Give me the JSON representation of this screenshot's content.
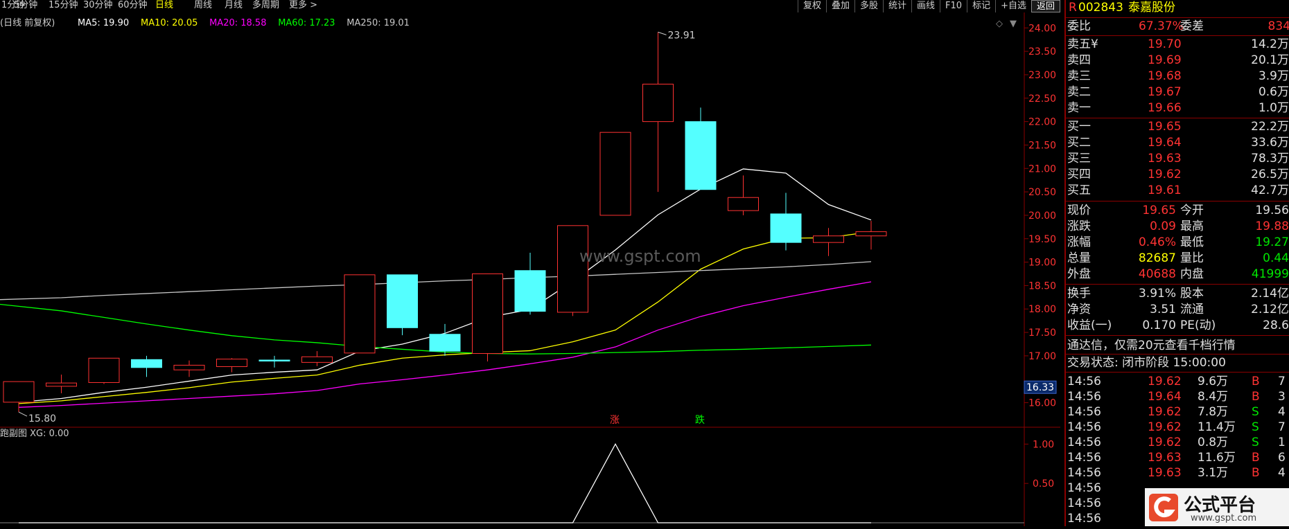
{
  "periods": [
    "1分钟",
    "5分钟",
    "15分钟",
    "30分钟",
    "60分钟",
    "日线",
    "周线",
    "月线",
    "多周期",
    "更多 >"
  ],
  "active_period": "日线",
  "toolbar": [
    "复权",
    "叠加",
    "多股",
    "统计",
    "画线",
    "F10",
    "标记",
    "+自选",
    "返回"
  ],
  "ma_legend": {
    "prefix": "(日线 前复权)",
    "items": [
      {
        "label": "MA5: 19.90",
        "color": "#ffffff"
      },
      {
        "label": "MA10: 20.05",
        "color": "#ffff00"
      },
      {
        "label": "MA20: 18.58",
        "color": "#ff00ff"
      },
      {
        "label": "MA60: 17.23",
        "color": "#00ff00"
      },
      {
        "label": "MA250: 19.01",
        "color": "#c8c8c8"
      }
    ]
  },
  "watermark": "www.gspt.com",
  "chart_data": {
    "type": "candlestick",
    "ylim": [
      15.55,
      24.3
    ],
    "yticks": [
      "24.00",
      "23.50",
      "23.00",
      "22.50",
      "22.00",
      "21.50",
      "21.00",
      "20.50",
      "20.00",
      "19.50",
      "19.00",
      "18.50",
      "18.00",
      "17.50",
      "17.00",
      "16.00"
    ],
    "current_price_tag": "16.33",
    "max_label": "23.91",
    "min_label": "15.80",
    "candles": [
      {
        "o": 16.01,
        "h": 16.45,
        "l": 15.8,
        "c": 16.45
      },
      {
        "o": 16.35,
        "h": 16.6,
        "l": 16.2,
        "c": 16.42
      },
      {
        "o": 16.43,
        "h": 16.95,
        "l": 16.4,
        "c": 16.95
      },
      {
        "o": 16.92,
        "h": 17.0,
        "l": 16.55,
        "c": 16.75
      },
      {
        "o": 16.7,
        "h": 16.9,
        "l": 16.55,
        "c": 16.8
      },
      {
        "o": 16.77,
        "h": 16.95,
        "l": 16.65,
        "c": 16.93
      },
      {
        "o": 16.91,
        "h": 17.0,
        "l": 16.75,
        "c": 16.9
      },
      {
        "o": 16.86,
        "h": 17.1,
        "l": 16.78,
        "c": 16.98
      },
      {
        "o": 17.06,
        "h": 18.73,
        "l": 17.06,
        "c": 18.73
      },
      {
        "o": 18.73,
        "h": 18.73,
        "l": 17.44,
        "c": 17.6
      },
      {
        "o": 17.46,
        "h": 17.68,
        "l": 17.0,
        "c": 17.1
      },
      {
        "o": 17.05,
        "h": 18.75,
        "l": 16.88,
        "c": 18.75
      },
      {
        "o": 18.82,
        "h": 19.2,
        "l": 17.88,
        "c": 17.95
      },
      {
        "o": 17.93,
        "h": 19.78,
        "l": 17.85,
        "c": 19.78
      },
      {
        "o": 20.0,
        "h": 21.77,
        "l": 20.0,
        "c": 21.77
      },
      {
        "o": 22.0,
        "h": 23.91,
        "l": 20.5,
        "c": 22.8
      },
      {
        "o": 22.0,
        "h": 22.3,
        "l": 20.55,
        "c": 20.55
      },
      {
        "o": 20.1,
        "h": 20.85,
        "l": 20.0,
        "c": 20.38
      },
      {
        "o": 20.03,
        "h": 20.48,
        "l": 19.25,
        "c": 19.42
      },
      {
        "o": 19.42,
        "h": 19.73,
        "l": 19.13,
        "c": 19.56
      },
      {
        "o": 19.56,
        "h": 19.88,
        "l": 19.27,
        "c": 19.65
      }
    ],
    "ma_lines": [
      {
        "name": "MA5",
        "color": "#ffffff",
        "values": [
          16.01,
          16.09,
          16.22,
          16.33,
          16.46,
          16.59,
          16.65,
          16.7,
          17.1,
          17.25,
          17.48,
          17.82,
          17.99,
          18.59,
          19.26,
          20.01,
          20.56,
          20.99,
          20.9,
          20.23,
          19.9
        ]
      },
      {
        "name": "MA10",
        "color": "#ffff00",
        "values": [
          15.98,
          16.04,
          16.13,
          16.22,
          16.32,
          16.44,
          16.52,
          16.59,
          16.8,
          16.95,
          17.02,
          17.07,
          17.11,
          17.3,
          17.55,
          18.15,
          18.85,
          19.28,
          19.51,
          19.52,
          19.65
        ]
      },
      {
        "name": "MA20",
        "color": "#ff00ff",
        "values": [
          15.9,
          15.94,
          15.99,
          16.04,
          16.09,
          16.14,
          16.19,
          16.26,
          16.4,
          16.49,
          16.59,
          16.7,
          16.83,
          16.97,
          17.19,
          17.55,
          17.84,
          18.07,
          18.25,
          18.42,
          18.58
        ]
      },
      {
        "name": "MA60",
        "color": "#00ff00",
        "values": [
          18.1,
          17.96,
          17.82,
          17.68,
          17.55,
          17.43,
          17.34,
          17.28,
          17.2,
          17.14,
          17.08,
          17.05,
          17.04,
          17.05,
          17.07,
          17.09,
          17.12,
          17.14,
          17.17,
          17.2,
          17.23
        ]
      },
      {
        "name": "MA250",
        "color": "#c8c8c8",
        "values": [
          18.2,
          18.24,
          18.29,
          18.33,
          18.37,
          18.41,
          18.45,
          18.49,
          18.52,
          18.56,
          18.6,
          18.63,
          18.67,
          18.7,
          18.74,
          18.78,
          18.82,
          18.86,
          18.9,
          18.95,
          19.01
        ]
      }
    ],
    "signals": [
      {
        "bar": 14,
        "text": "涨",
        "color": "#ff3333"
      },
      {
        "bar": 16,
        "text": "跌",
        "color": "#00ff00"
      }
    ]
  },
  "sub_chart": {
    "title": "跑副图 XG: 0.00",
    "ylim": [
      0,
      1.1
    ],
    "yticks": [
      "1.00",
      "0.50"
    ],
    "values": [
      0,
      0,
      0,
      0,
      0,
      0,
      0,
      0,
      0,
      0,
      0,
      0,
      0,
      0,
      1,
      0,
      0,
      0,
      0,
      0,
      0
    ]
  },
  "stock": {
    "code": "002843",
    "name": "泰嘉股份",
    "badge": "R"
  },
  "weibi": {
    "label": "委比",
    "value": "67.37%",
    "label2": "委差",
    "value2": "834"
  },
  "sells": [
    {
      "label": "卖五",
      "mark": "¥",
      "price": "19.70",
      "vol": "14.2万"
    },
    {
      "label": "卖四",
      "mark": "",
      "price": "19.69",
      "vol": "20.1万"
    },
    {
      "label": "卖三",
      "mark": "",
      "price": "19.68",
      "vol": "3.9万"
    },
    {
      "label": "卖二",
      "mark": "",
      "price": "19.67",
      "vol": "0.6万"
    },
    {
      "label": "卖一",
      "mark": "",
      "price": "19.66",
      "vol": "1.0万"
    }
  ],
  "buys": [
    {
      "label": "买一",
      "price": "19.65",
      "vol": "22.2万"
    },
    {
      "label": "买二",
      "price": "19.64",
      "vol": "33.6万"
    },
    {
      "label": "买三",
      "price": "19.63",
      "vol": "78.3万"
    },
    {
      "label": "买四",
      "price": "19.62",
      "vol": "26.5万"
    },
    {
      "label": "买五",
      "price": "19.61",
      "vol": "42.7万"
    }
  ],
  "quote": [
    {
      "l1": "现价",
      "v1": "19.65",
      "c1": "red",
      "l2": "今开",
      "v2": "19.56",
      "c2": "wht"
    },
    {
      "l1": "涨跌",
      "v1": "0.09",
      "c1": "red",
      "l2": "最高",
      "v2": "19.88",
      "c2": "red"
    },
    {
      "l1": "涨幅",
      "v1": "0.46%",
      "c1": "red",
      "l2": "最低",
      "v2": "19.27",
      "c2": "grn"
    },
    {
      "l1": "总量",
      "v1": "82687",
      "c1": "yel",
      "l2": "量比",
      "v2": "0.44",
      "c2": "grn"
    },
    {
      "l1": "外盘",
      "v1": "40688",
      "c1": "red",
      "l2": "内盘",
      "v2": "41999",
      "c2": "grn"
    }
  ],
  "fundamentals": [
    {
      "l1": "换手",
      "v1": "3.91%",
      "l2": "股本",
      "v2": "2.14亿"
    },
    {
      "l1": "净资",
      "v1": "3.51",
      "l2": "流通",
      "v2": "2.12亿"
    },
    {
      "l1": "收益(一)",
      "v1": "0.170",
      "l2": "PE(动)",
      "v2": "28.6"
    }
  ],
  "promo": "通达信，仅需20元查看千档行情",
  "trade_status": "交易状态: 闭市阶段 15:00:00",
  "ticks": [
    {
      "t": "14:56",
      "p": "19.62",
      "v": "9.6万",
      "bs": "B",
      "n": "7"
    },
    {
      "t": "14:56",
      "p": "19.64",
      "v": "8.4万",
      "bs": "B",
      "n": "3"
    },
    {
      "t": "14:56",
      "p": "19.62",
      "v": "7.8万",
      "bs": "S",
      "n": "4"
    },
    {
      "t": "14:56",
      "p": "19.62",
      "v": "11.4万",
      "bs": "S",
      "n": "7"
    },
    {
      "t": "14:56",
      "p": "19.62",
      "v": "0.8万",
      "bs": "S",
      "n": "1"
    },
    {
      "t": "14:56",
      "p": "19.63",
      "v": "11.6万",
      "bs": "B",
      "n": "6"
    },
    {
      "t": "14:56",
      "p": "19.63",
      "v": "3.1万",
      "bs": "B",
      "n": "4"
    },
    {
      "t": "14:56",
      "p": "",
      "v": "",
      "bs": "",
      "n": ""
    },
    {
      "t": "14:56",
      "p": "",
      "v": "",
      "bs": "",
      "n": ""
    },
    {
      "t": "14:56",
      "p": "",
      "v": "",
      "bs": "",
      "n": ""
    }
  ],
  "logo": {
    "text": "公式平台",
    "url": "www.gspt.com"
  }
}
